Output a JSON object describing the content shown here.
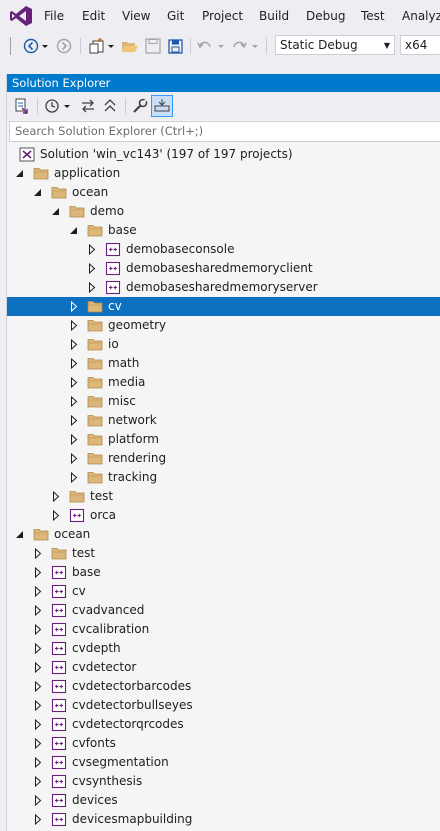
{
  "menu": {
    "logo_icon": "visual-studio-logo",
    "items": [
      "File",
      "Edit",
      "View",
      "Git",
      "Project",
      "Build",
      "Debug",
      "Test",
      "Analyze"
    ]
  },
  "toolbar": {
    "configuration": "Static Debug",
    "platform": "x64"
  },
  "solution_explorer": {
    "title": "Solution Explorer",
    "search_placeholder": "Search Solution Explorer (Ctrl+;)",
    "tree": [
      {
        "label": "Solution 'win_vc143' (197 of 197 projects)",
        "depth": 0,
        "type": "solution",
        "expander": "none",
        "selected": false
      },
      {
        "label": "application",
        "depth": 1,
        "type": "folder",
        "expander": "expanded",
        "selected": false
      },
      {
        "label": "ocean",
        "depth": 2,
        "type": "folder",
        "expander": "expanded",
        "selected": false
      },
      {
        "label": "demo",
        "depth": 3,
        "type": "folder",
        "expander": "expanded",
        "selected": false
      },
      {
        "label": "base",
        "depth": 4,
        "type": "folder",
        "expander": "expanded",
        "selected": false
      },
      {
        "label": "demobaseconsole",
        "depth": 5,
        "type": "project",
        "expander": "collapsed",
        "selected": false
      },
      {
        "label": "demobasesharedmemoryclient",
        "depth": 5,
        "type": "project",
        "expander": "collapsed",
        "selected": false
      },
      {
        "label": "demobasesharedmemoryserver",
        "depth": 5,
        "type": "project",
        "expander": "collapsed",
        "selected": false
      },
      {
        "label": "cv",
        "depth": 4,
        "type": "folder",
        "expander": "collapsed",
        "selected": true
      },
      {
        "label": "geometry",
        "depth": 4,
        "type": "folder",
        "expander": "collapsed",
        "selected": false
      },
      {
        "label": "io",
        "depth": 4,
        "type": "folder",
        "expander": "collapsed",
        "selected": false
      },
      {
        "label": "math",
        "depth": 4,
        "type": "folder",
        "expander": "collapsed",
        "selected": false
      },
      {
        "label": "media",
        "depth": 4,
        "type": "folder",
        "expander": "collapsed",
        "selected": false
      },
      {
        "label": "misc",
        "depth": 4,
        "type": "folder",
        "expander": "collapsed",
        "selected": false
      },
      {
        "label": "network",
        "depth": 4,
        "type": "folder",
        "expander": "collapsed",
        "selected": false
      },
      {
        "label": "platform",
        "depth": 4,
        "type": "folder",
        "expander": "collapsed",
        "selected": false
      },
      {
        "label": "rendering",
        "depth": 4,
        "type": "folder",
        "expander": "collapsed",
        "selected": false
      },
      {
        "label": "tracking",
        "depth": 4,
        "type": "folder",
        "expander": "collapsed",
        "selected": false
      },
      {
        "label": "test",
        "depth": 3,
        "type": "folder",
        "expander": "collapsed",
        "selected": false
      },
      {
        "label": "orca",
        "depth": 3,
        "type": "project",
        "expander": "collapsed",
        "selected": false
      },
      {
        "label": "ocean",
        "depth": 1,
        "type": "folder",
        "expander": "expanded",
        "selected": false
      },
      {
        "label": "test",
        "depth": 2,
        "type": "folder",
        "expander": "collapsed",
        "selected": false
      },
      {
        "label": "base",
        "depth": 2,
        "type": "project",
        "expander": "collapsed",
        "selected": false
      },
      {
        "label": "cv",
        "depth": 2,
        "type": "project",
        "expander": "collapsed",
        "selected": false
      },
      {
        "label": "cvadvanced",
        "depth": 2,
        "type": "project",
        "expander": "collapsed",
        "selected": false
      },
      {
        "label": "cvcalibration",
        "depth": 2,
        "type": "project",
        "expander": "collapsed",
        "selected": false
      },
      {
        "label": "cvdepth",
        "depth": 2,
        "type": "project",
        "expander": "collapsed",
        "selected": false
      },
      {
        "label": "cvdetector",
        "depth": 2,
        "type": "project",
        "expander": "collapsed",
        "selected": false
      },
      {
        "label": "cvdetectorbarcodes",
        "depth": 2,
        "type": "project",
        "expander": "collapsed",
        "selected": false
      },
      {
        "label": "cvdetectorbullseyes",
        "depth": 2,
        "type": "project",
        "expander": "collapsed",
        "selected": false
      },
      {
        "label": "cvdetectorqrcodes",
        "depth": 2,
        "type": "project",
        "expander": "collapsed",
        "selected": false
      },
      {
        "label": "cvfonts",
        "depth": 2,
        "type": "project",
        "expander": "collapsed",
        "selected": false
      },
      {
        "label": "cvsegmentation",
        "depth": 2,
        "type": "project",
        "expander": "collapsed",
        "selected": false
      },
      {
        "label": "cvsynthesis",
        "depth": 2,
        "type": "project",
        "expander": "collapsed",
        "selected": false
      },
      {
        "label": "devices",
        "depth": 2,
        "type": "project",
        "expander": "collapsed",
        "selected": false
      },
      {
        "label": "devicesmapbuilding",
        "depth": 2,
        "type": "project",
        "expander": "collapsed",
        "selected": false
      }
    ]
  },
  "colors": {
    "accent": "#007acc",
    "selection": "#0e70c0",
    "folder": "#dcb67a",
    "project": "#68217a"
  }
}
